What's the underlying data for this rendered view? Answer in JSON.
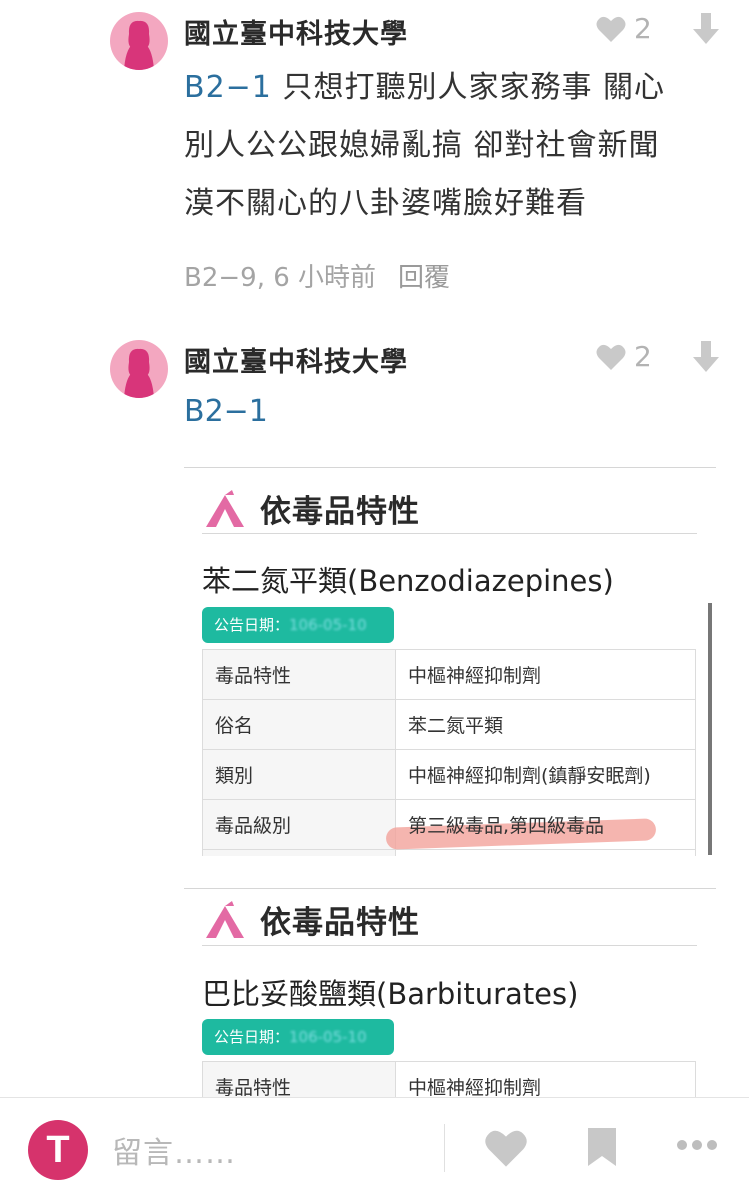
{
  "comments": [
    {
      "author": "國立臺中科技大學",
      "likes": "2",
      "reply_ref": "B2−1",
      "text_lines": [
        "只想打聽別人家家務事  關心",
        "別人公公跟媳婦亂搞  卻對社會新聞",
        "漠不關心的八卦婆嘴臉好難看"
      ],
      "floor": "B2−9, 6 小時前",
      "reply_label": "回覆"
    },
    {
      "author": "國立臺中科技大學",
      "likes": "2",
      "reply_ref": "B2−1"
    }
  ],
  "cards": [
    {
      "heading": "依毒品特性",
      "drug_name": "苯二氮平類(Benzodiazepines)",
      "date_label": "公告日期：",
      "date_value": "106-05-10",
      "rows": [
        {
          "key": "毒品特性",
          "value": "中樞神經抑制劑"
        },
        {
          "key": "俗名",
          "value": "苯二氮平類"
        },
        {
          "key": "類別",
          "value": "中樞神經抑制劑(鎮靜安眠劑)"
        },
        {
          "key": "毒品級別",
          "value": "第三級毒品,第四級毒品"
        }
      ]
    },
    {
      "heading": "依毒品特性",
      "drug_name": "巴比妥酸鹽類(Barbiturates)",
      "date_label": "公告日期：",
      "date_value": "106-05-10",
      "rows": [
        {
          "key": "毒品特性",
          "value": "中樞神經抑制劑"
        }
      ]
    }
  ],
  "bottom_bar": {
    "avatar_letter": "T",
    "placeholder": "留言……",
    "icons": [
      "heart-icon",
      "bookmark-icon",
      "more-icon"
    ]
  },
  "colors": {
    "link_blue": "#2b6f9e",
    "avatar_pink": "#f3a7c0",
    "user_avatar": "#d6336c",
    "teal_pill": "#1ebaa0",
    "highlight": "#f3a39b"
  }
}
